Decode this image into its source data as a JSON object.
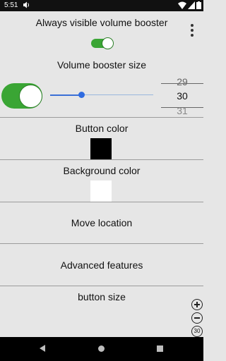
{
  "status_bar": {
    "time": "5:51"
  },
  "settings": {
    "always_visible_label": "Always visible volume booster",
    "always_visible_enabled": true,
    "size_label": "Volume booster size",
    "size_toggle_enabled": true,
    "slider_fraction": 0.3,
    "picker": {
      "prev": "29",
      "current": "30",
      "next": "31"
    },
    "button_color_label": "Button color",
    "button_color": "#000000",
    "background_color_label": "Background color",
    "background_color": "#ffffff",
    "move_location_label": "Move location",
    "advanced_features_label": "Advanced features",
    "button_size_label": "button size"
  },
  "zoom": {
    "value": "30"
  },
  "colors": {
    "accent_green": "#3aa534",
    "slider_blue": "#2f6be0"
  },
  "icons": [
    "volume-icon",
    "wifi-icon",
    "cell-signal-icon",
    "battery-icon",
    "overflow-menu-icon",
    "zoom-in-icon",
    "zoom-out-icon",
    "back-icon",
    "home-icon",
    "recents-icon"
  ]
}
